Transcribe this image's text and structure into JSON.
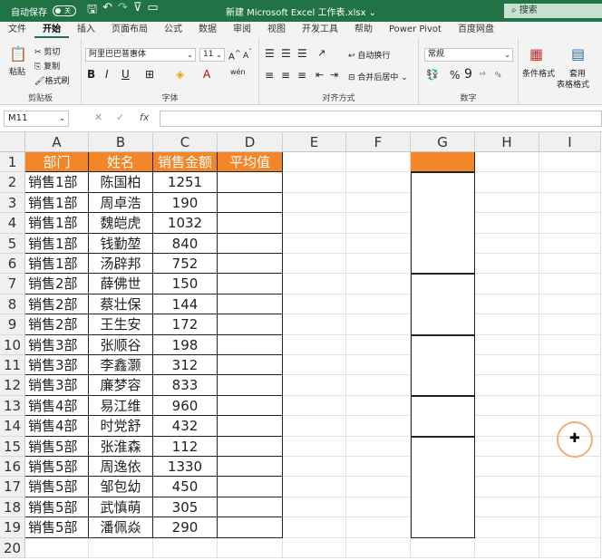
{
  "titlebar": {
    "autosave_label": "自动保存",
    "autosave_state": "关",
    "title": "新建 Microsoft Excel 工作表.xlsx ⌄",
    "search_placeholder": "搜索"
  },
  "tabs": [
    "文件",
    "开始",
    "插入",
    "页面布局",
    "公式",
    "数据",
    "审阅",
    "视图",
    "开发工具",
    "帮助",
    "Power Pivot",
    "百度网盘"
  ],
  "active_tab": "开始",
  "ribbon": {
    "clipboard": {
      "paste": "粘贴",
      "cut": "剪切",
      "copy": "复制",
      "format_painter": "格式刷",
      "label": "剪贴板"
    },
    "font": {
      "font_name": "阿里巴巴普惠体",
      "font_size": "11",
      "label": "字体"
    },
    "alignment": {
      "wrap": "自动换行",
      "merge": "合并后居中",
      "label": "对齐方式"
    },
    "number": {
      "format": "常规",
      "label": "数字"
    },
    "styles": {
      "conditional": "条件格式",
      "table_format_1": "套用",
      "table_format_2": "表格格式"
    }
  },
  "formula_bar": {
    "name_box": "M11",
    "cancel": "✕",
    "enter": "✓",
    "fx": "fx",
    "value": ""
  },
  "sheet": {
    "columns": [
      "A",
      "B",
      "C",
      "D",
      "E",
      "F",
      "G",
      "H",
      "I"
    ],
    "headers": [
      "部门",
      "姓名",
      "销售金额",
      "平均值"
    ],
    "g1_header": "",
    "rows": [
      [
        "销售1部",
        "陈国柏",
        "1251"
      ],
      [
        "销售1部",
        "周卓浩",
        "190"
      ],
      [
        "销售1部",
        "魏皑虎",
        "1032"
      ],
      [
        "销售1部",
        "钱勤堃",
        "840"
      ],
      [
        "销售1部",
        "汤辟邦",
        "752"
      ],
      [
        "销售2部",
        "薛佛世",
        "150"
      ],
      [
        "销售2部",
        "蔡壮保",
        "144"
      ],
      [
        "销售2部",
        "王生安",
        "172"
      ],
      [
        "销售3部",
        "张顺谷",
        "198"
      ],
      [
        "销售3部",
        "李鑫灏",
        "312"
      ],
      [
        "销售3部",
        "廉梦容",
        "833"
      ],
      [
        "销售4部",
        "易江维",
        "960"
      ],
      [
        "销售4部",
        "时党舒",
        "432"
      ],
      [
        "销售5部",
        "张淮森",
        "112"
      ],
      [
        "销售5部",
        "周逸依",
        "1330"
      ],
      [
        "销售5部",
        "邹包幼",
        "450"
      ],
      [
        "销售5部",
        "武慎萌",
        "305"
      ],
      [
        "销售5部",
        "潘佩焱",
        "290"
      ]
    ],
    "row_numbers": [
      "1",
      "2",
      "3",
      "4",
      "5",
      "6",
      "7",
      "8",
      "9",
      "10",
      "11",
      "12",
      "13",
      "14",
      "15",
      "16",
      "17",
      "18",
      "19",
      "20"
    ],
    "header_color": "#f4862a",
    "accent": "#217346"
  }
}
